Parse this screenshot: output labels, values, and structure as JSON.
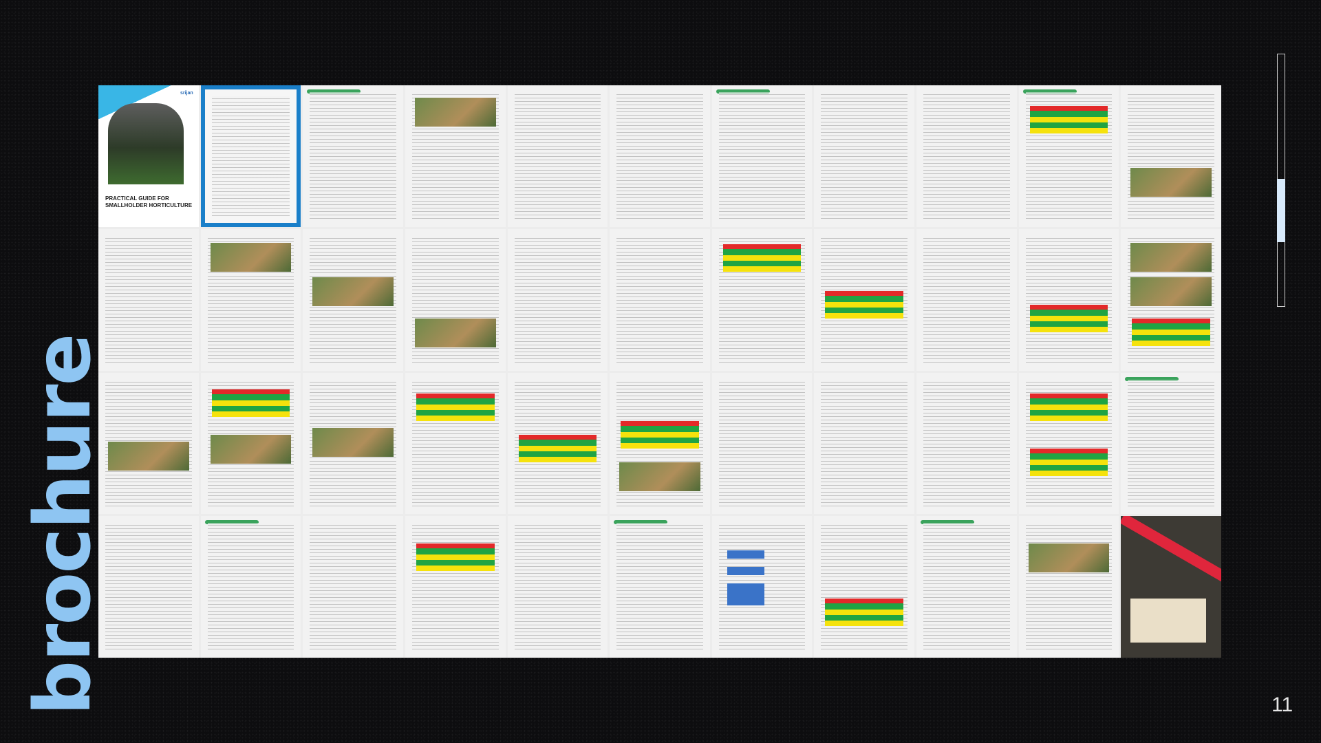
{
  "slide": {
    "vertical_title": "brochure",
    "page_number": "11"
  },
  "brochure": {
    "cover_title": "PRACTICAL GUIDE FOR SMALLHOLDER HORTICULTURE",
    "logo_text": "srijan"
  }
}
